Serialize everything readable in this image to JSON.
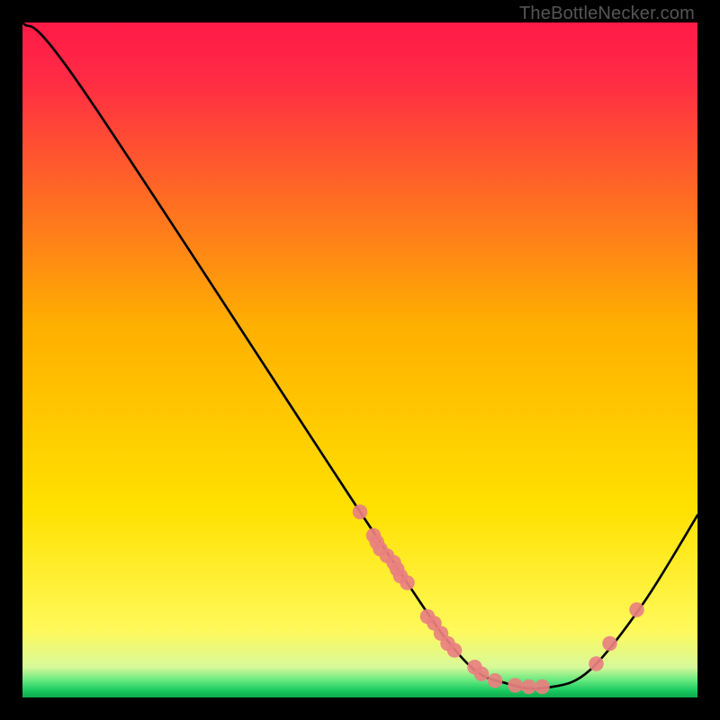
{
  "attribution": "TheBottleNecker.com",
  "chart_data": {
    "type": "line",
    "title": "",
    "xlabel": "",
    "ylabel": "",
    "xlim": [
      0,
      100
    ],
    "ylim": [
      0,
      100
    ],
    "gradient": {
      "top": "#ff1a47",
      "mid": "#ffe100",
      "bottom_band": "#1ee36e",
      "bottom_edge": "#0fa84c"
    },
    "curve": [
      {
        "x": 0,
        "y": 100
      },
      {
        "x": 9,
        "y": 90
      },
      {
        "x": 52,
        "y": 24.5
      },
      {
        "x": 65,
        "y": 6
      },
      {
        "x": 72,
        "y": 2
      },
      {
        "x": 78,
        "y": 1.5
      },
      {
        "x": 84,
        "y": 4
      },
      {
        "x": 92,
        "y": 14
      },
      {
        "x": 100,
        "y": 27
      }
    ],
    "scatter_main": [
      {
        "x": 50,
        "y": 27.5
      },
      {
        "x": 52,
        "y": 24
      },
      {
        "x": 52.5,
        "y": 23
      },
      {
        "x": 53,
        "y": 22
      },
      {
        "x": 54,
        "y": 21
      },
      {
        "x": 55,
        "y": 20
      },
      {
        "x": 55.5,
        "y": 19
      },
      {
        "x": 56,
        "y": 18
      },
      {
        "x": 57,
        "y": 17
      },
      {
        "x": 60,
        "y": 12
      },
      {
        "x": 61,
        "y": 11
      },
      {
        "x": 62,
        "y": 9.5
      },
      {
        "x": 63,
        "y": 8
      },
      {
        "x": 64,
        "y": 7
      },
      {
        "x": 67,
        "y": 4.5
      },
      {
        "x": 68,
        "y": 3.5
      },
      {
        "x": 70,
        "y": 2.5
      },
      {
        "x": 73,
        "y": 1.8
      },
      {
        "x": 75,
        "y": 1.6
      },
      {
        "x": 77,
        "y": 1.6
      }
    ],
    "scatter_right": [
      {
        "x": 85,
        "y": 5
      },
      {
        "x": 87,
        "y": 8
      },
      {
        "x": 91,
        "y": 13
      }
    ]
  }
}
